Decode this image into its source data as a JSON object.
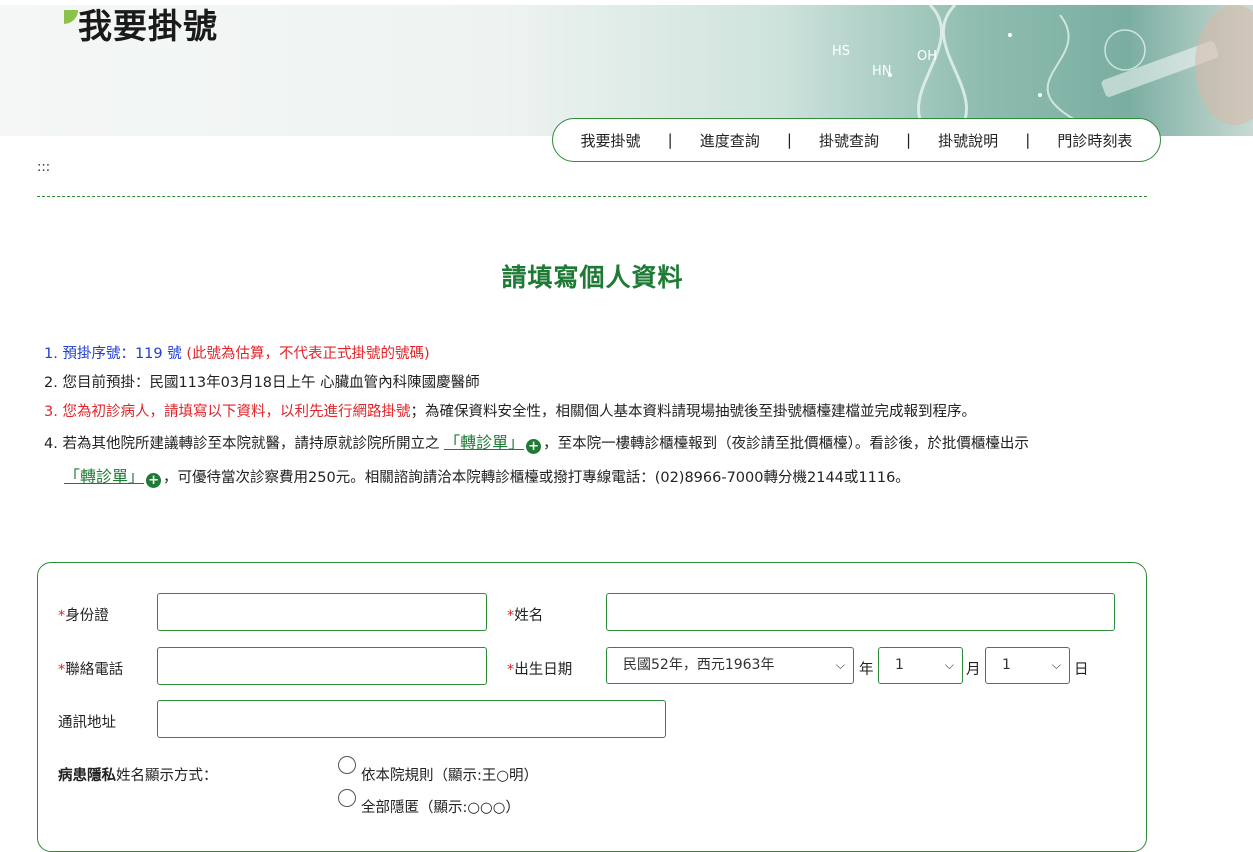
{
  "banner": {
    "title": "我要掛號",
    "deco_labels": [
      "HS",
      "HN",
      "OH"
    ]
  },
  "nav": {
    "items": [
      "我要掛號",
      "進度查詢",
      "掛號查詢",
      "掛號說明",
      "門診時刻表"
    ],
    "separator": "|"
  },
  "accesskey": ":::",
  "page_title": "請填寫個人資料",
  "notes": {
    "n1_num": "1.",
    "n1_label": "預掛序號：119 號",
    "n1_red": "(此號為估算，不代表正式掛號的號碼)",
    "n2_num": "2.",
    "n2_text": "您目前預掛：民國113年03月18日上午 心臟血管內科陳國慶醫師",
    "n3_num": "3.",
    "n3_red": "您為初診病人，請填寫以下資料，以利先進行網路掛號",
    "n3_text": "；為確保資料安全性，相關個人基本資料請現場抽號後至掛號櫃檯建檔並完成報到程序。",
    "n4_num": "4.",
    "n4_pre": "若為其他院所建議轉診至本院就醫，請持原就診院所開立之",
    "n4_link": "「轉診單」",
    "n4_mid": "，至本院一樓轉診櫃檯報到（夜診請至批價櫃檯）。看診後，於批價櫃檯出示",
    "n4_link2": "「轉診單」",
    "n4_post": "，可優待當次診察費用250元。相關諮詢請洽本院轉診櫃檯或撥打專線電話：(02)8966-7000轉分機2144或1116。"
  },
  "form": {
    "required_mark": "*",
    "id_label": "身份證",
    "id_value": "",
    "name_label": "姓名",
    "name_value": "",
    "phone_label": "聯絡電話",
    "phone_value": "",
    "birth_label": "出生日期",
    "birth_year": "民國52年，西元1963年",
    "year_unit": "年",
    "birth_month": "1",
    "month_unit": "月",
    "birth_day": "1",
    "day_unit": "日",
    "address_label": "通訊地址",
    "address_value": "",
    "privacy_bold": "病患隱私",
    "privacy_label": "姓名顯示方式：",
    "privacy_option1": "依本院規則（顯示:王○明）",
    "privacy_option2": "全部隱匿（顯示:○○○）"
  },
  "colors": {
    "accent_green": "#1e7a34",
    "border_green": "#2e8b3a",
    "required_red": "#e0252a",
    "note_blue": "#1f3fd1"
  }
}
